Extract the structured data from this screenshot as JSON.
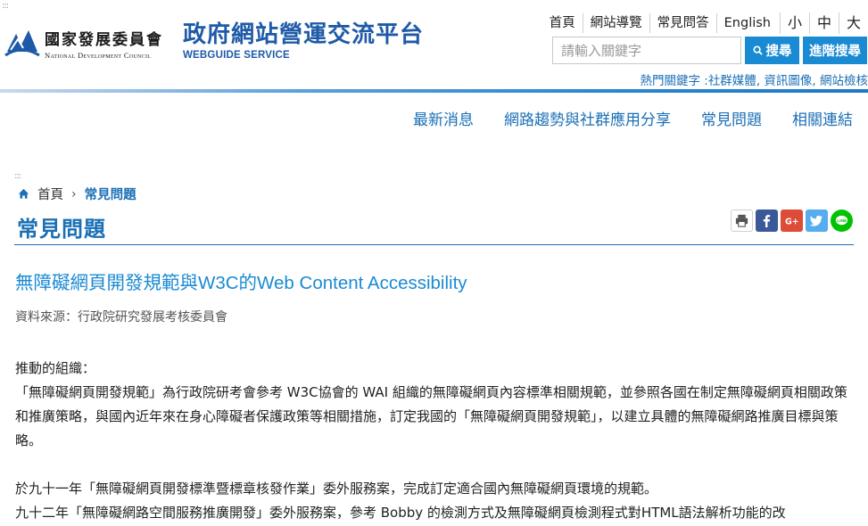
{
  "accesskey_top": ":::",
  "accesskey_mid": ":::",
  "header": {
    "org_cn": "國家發展委員會",
    "org_en": "National Development Council",
    "site_title": "政府網站營運交流平台",
    "site_subtitle": "WEBGUIDE SERVICE",
    "top_links": [
      "首頁",
      "網站導覽",
      "常見問答",
      "English"
    ],
    "font_sizes": [
      "小",
      "中",
      "大"
    ],
    "search": {
      "placeholder": "請輸入關鍵字",
      "search_label": "搜尋",
      "advanced_label": "進階搜尋"
    },
    "hot_keywords_label": "熱門關鍵字 :",
    "hot_keywords": [
      "社群媒體",
      "資訊圖像",
      "網站檢核"
    ]
  },
  "main_nav": [
    "最新消息",
    "網路趨勢與社群應用分享",
    "常見問題",
    "相關連結"
  ],
  "breadcrumb": {
    "home": "首頁",
    "separator": "›",
    "current": "常見問題"
  },
  "page_title": "常見問題",
  "share_icons": [
    "print-icon",
    "facebook-icon",
    "google-plus-icon",
    "twitter-icon",
    "line-icon"
  ],
  "article": {
    "title": "無障礙網頁開發規範與W3C的Web Content Accessibility",
    "source": "資料來源：行政院研究發展考核委員會",
    "paragraphs": [
      "推動的組織：",
      "「無障礙網頁開發規範」為行政院研考會參考 W3C協會的 WAI 組織的無障礙網頁內容標準相關規範，並參照各國在制定無障礙網頁相關政策和推廣策略，與國內近年來在身心障礙者保護政策等相關措施，訂定我國的「無障礙網頁開發規範」，以建立具體的無障礙網路推廣目標與策略。",
      "於九十一年「無障礙網頁開發標準暨標章核發作業」委外服務案，完成訂定適合國內無障礙網頁環境的規範。",
      "九十二年「無障礙網路空間服務推廣開發」委外服務案，參考 Bobby 的檢測方式及無障礙網頁檢測程式對HTML語法解析功能的改"
    ]
  },
  "colors": {
    "primary_blue": "#1a6fb5",
    "button_blue": "#1a8ad3",
    "facebook": "#3b5998",
    "google_plus": "#dd4b39",
    "twitter": "#55acee",
    "line": "#00c300"
  }
}
